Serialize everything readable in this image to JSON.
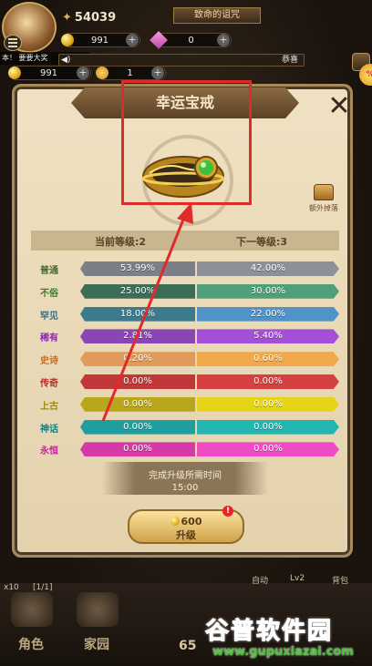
{
  "hud": {
    "power": "54039",
    "stage_title": "致命的诅咒",
    "gold": "991",
    "gems": "0",
    "gold2": "991",
    "stamina": "1",
    "notice": "本！ 要要大奖",
    "chat_right": "恭喜"
  },
  "dialog": {
    "title": "幸运宝戒",
    "extra_drop_label": "额外掉落",
    "col_current": "当前等级:2",
    "col_next": "下一等级:3",
    "rows": [
      {
        "name": "普通",
        "current": "53.99%",
        "next": "42.00%",
        "c1": "#7c7f86",
        "c2": "#8d9096",
        "text": "#4c6a2f"
      },
      {
        "name": "不俗",
        "current": "25.00%",
        "next": "30.00%",
        "c1": "#3c6d57",
        "c2": "#4fa07a",
        "text": "#3d7a2b"
      },
      {
        "name": "罕见",
        "current": "18.00%",
        "next": "22.00%",
        "c1": "#3b7a8f",
        "c2": "#4f93c9",
        "text": "#2f6c8a"
      },
      {
        "name": "稀有",
        "current": "2.81%",
        "next": "5.40%",
        "c1": "#8b46b5",
        "c2": "#a34fd6",
        "text": "#8a2aa8"
      },
      {
        "name": "史诗",
        "current": "0.20%",
        "next": "0.60%",
        "c1": "#e09a5a",
        "c2": "#f0a84a",
        "text": "#c86a1c"
      },
      {
        "name": "传奇",
        "current": "0.00%",
        "next": "0.00%",
        "c1": "#c23838",
        "c2": "#d64040",
        "text": "#b82a2a"
      },
      {
        "name": "上古",
        "current": "0.00%",
        "next": "0.00%",
        "c1": "#b8a71c",
        "c2": "#e6d41a",
        "text": "#9a8a10"
      },
      {
        "name": "神话",
        "current": "0.00%",
        "next": "0.00%",
        "c1": "#1f9e9e",
        "c2": "#23b6b0",
        "text": "#15807a"
      },
      {
        "name": "永恒",
        "current": "0.00%",
        "next": "0.00%",
        "c1": "#d63aa8",
        "c2": "#ef4cc4",
        "text": "#c5259a"
      }
    ],
    "time_label": "完成升级所需时间",
    "time_value": "15:00",
    "upgrade_cost": "600",
    "upgrade_label": "升级",
    "alert": "!"
  },
  "bottom": {
    "nav_role": "角色",
    "nav_home": "家园",
    "nav_num": "65",
    "auto": "自动",
    "lv": "Lv2",
    "bag": "背包",
    "left_count": "[1/1]",
    "left_tag": "x10"
  },
  "watermark": {
    "title": "谷普软件园",
    "url": "www.gupuxiazai.com"
  }
}
